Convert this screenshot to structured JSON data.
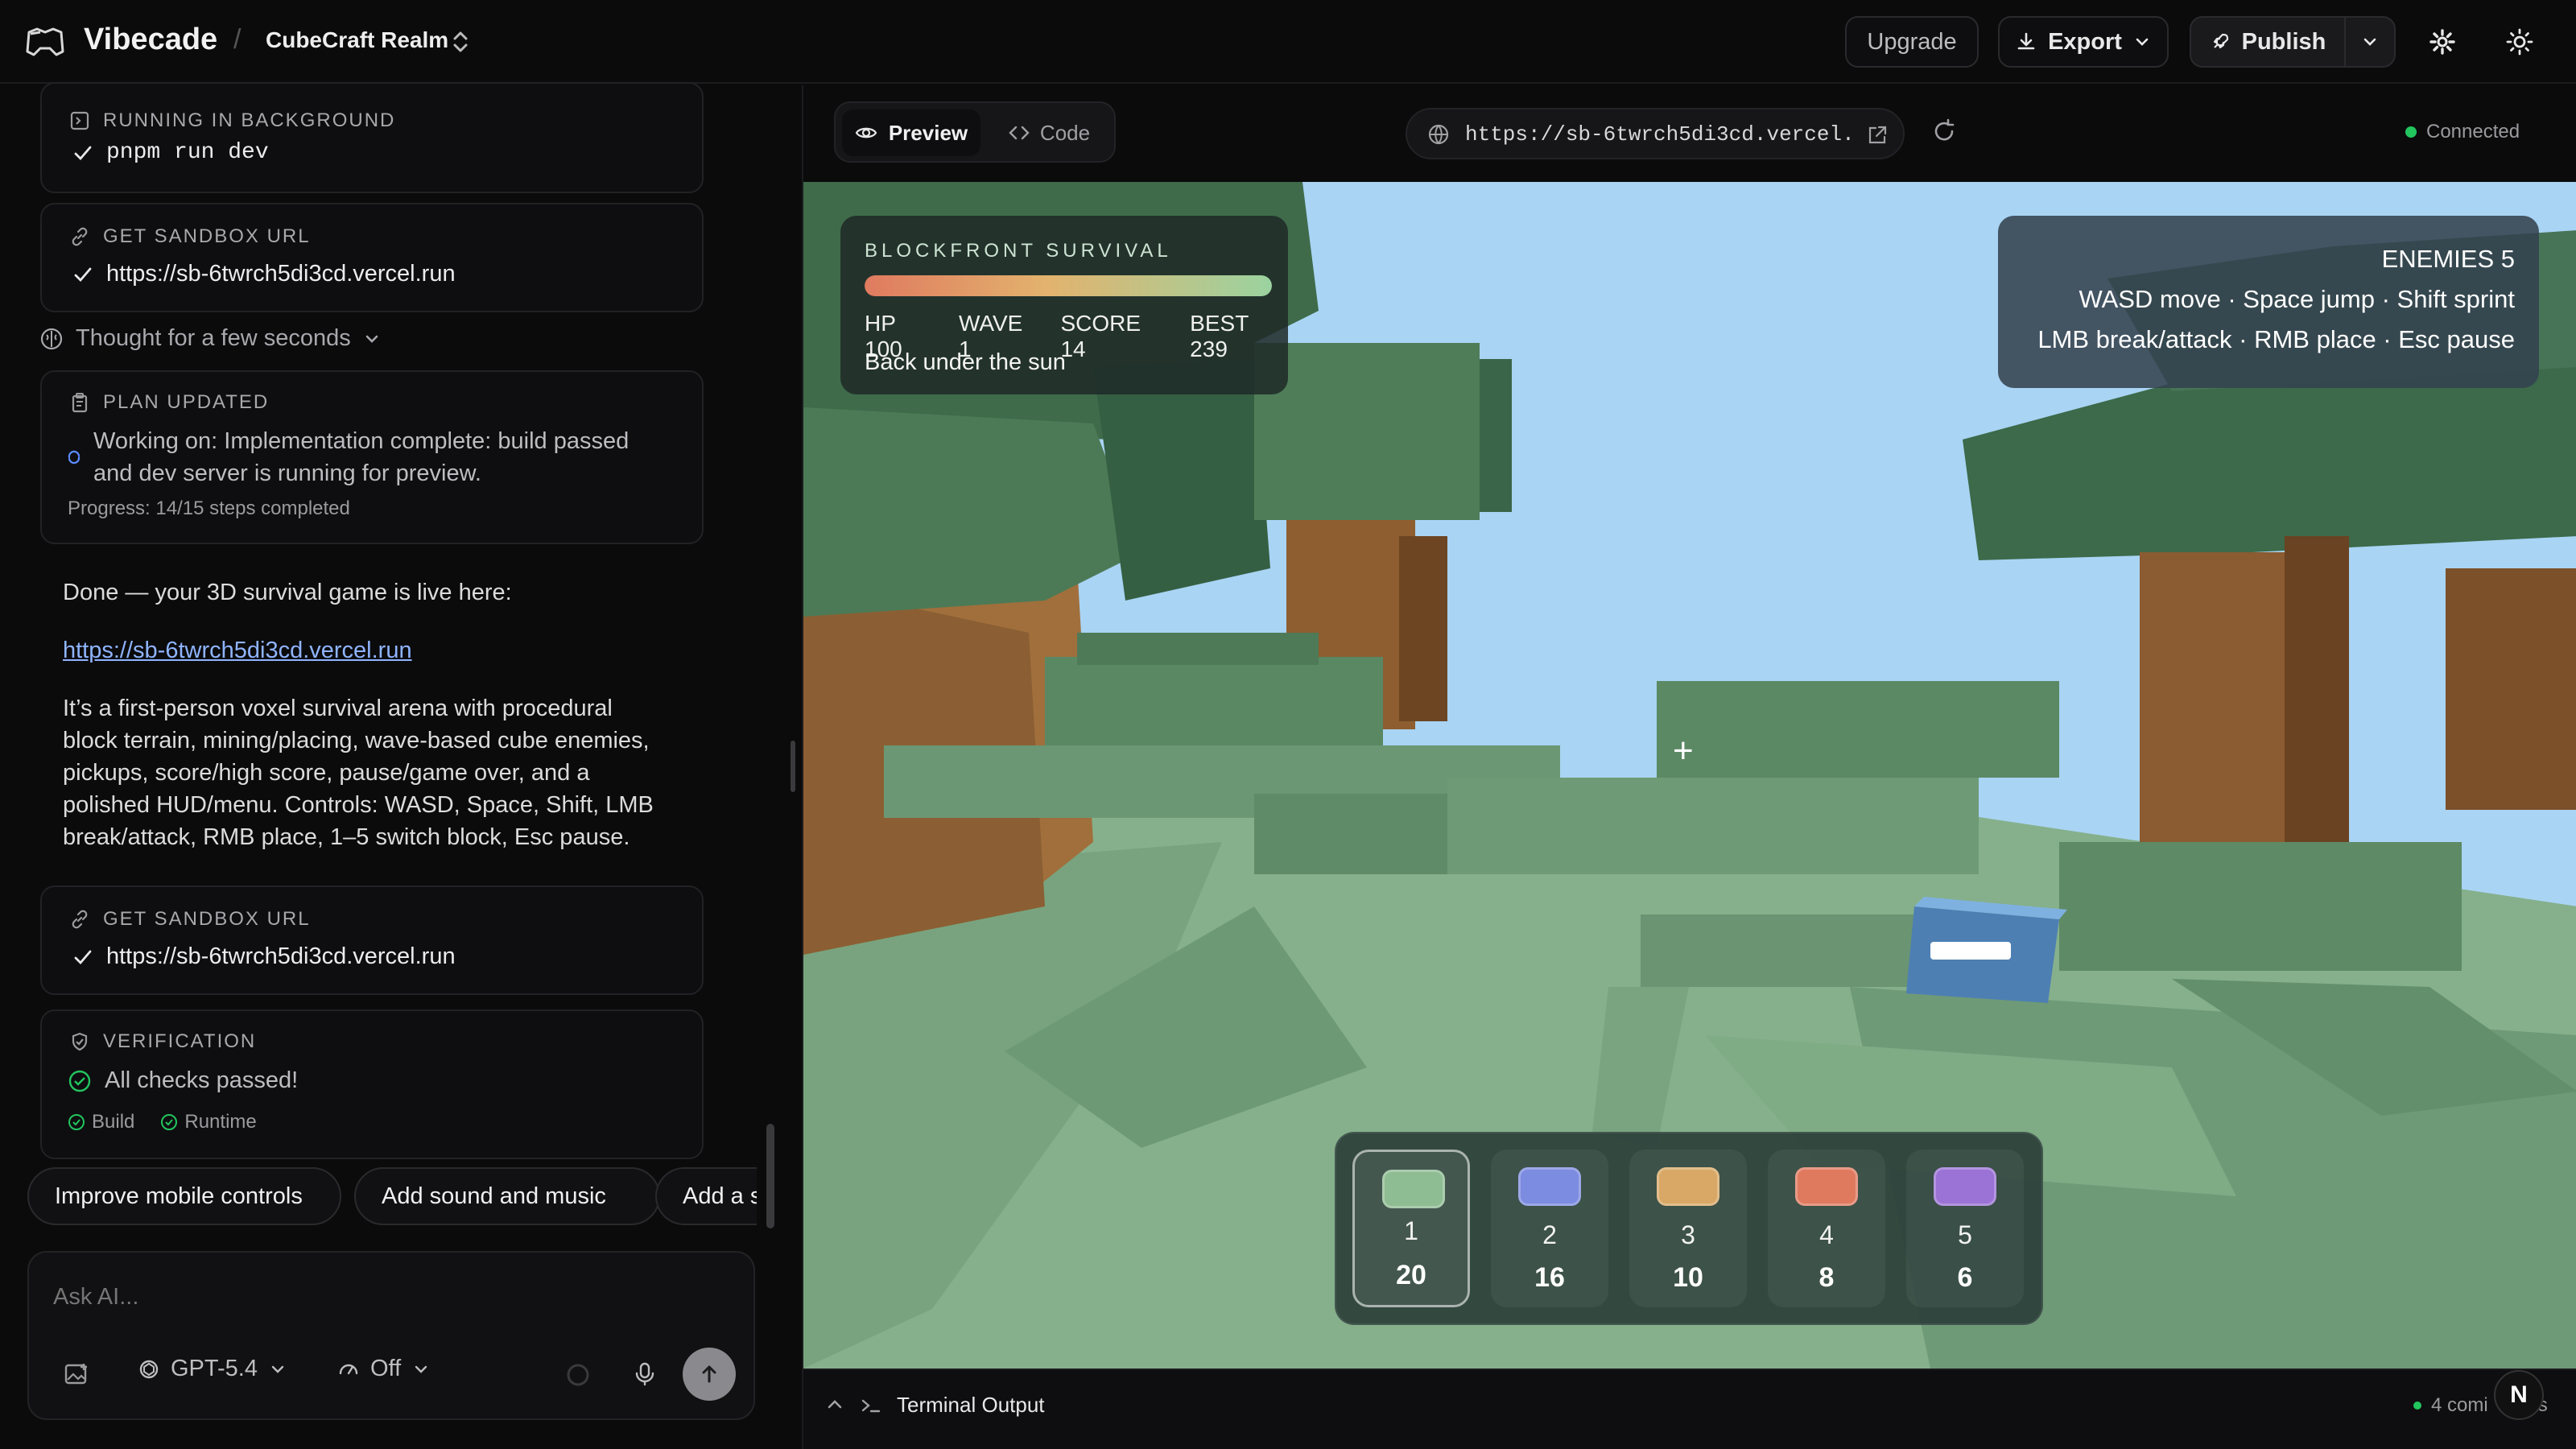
{
  "app": {
    "brand": "Vibecade",
    "separator": "/",
    "project_name": "CubeCraft Realm"
  },
  "header": {
    "upgrade_label": "Upgrade",
    "export_label": "Export",
    "publish_label": "Publish"
  },
  "chat": {
    "running_card": {
      "title": "RUNNING IN BACKGROUND",
      "command": "pnpm run dev"
    },
    "sandbox_card_1": {
      "title": "GET SANDBOX URL",
      "url": "https://sb-6twrch5di3cd.vercel.run"
    },
    "thought": "Thought for a few seconds",
    "plan_card": {
      "title": "PLAN UPDATED",
      "line1": "Working on: Implementation complete: build passed",
      "line2": "and dev server is running for preview.",
      "progress": "Progress: 14/15 steps completed"
    },
    "done_text": "Done — your 3D survival game is live here:",
    "live_link": "https://sb-6twrch5di3cd.vercel.run",
    "description_lines": [
      "It’s a first-person voxel survival arena with procedural",
      "block terrain, mining/placing, wave-based cube enemies,",
      "pickups, score/high score, pause/game over, and a",
      "polished HUD/menu. Controls: WASD, Space, Shift, LMB",
      "break/attack, RMB place, 1–5 switch block, Esc pause."
    ],
    "sandbox_card_2": {
      "title": "GET SANDBOX URL",
      "url": "https://sb-6twrch5di3cd.vercel.run"
    },
    "verification_card": {
      "title": "VERIFICATION",
      "status": "All checks passed!",
      "check_build": "Build",
      "check_runtime": "Runtime"
    },
    "suggestions": [
      "Improve mobile controls",
      "Add sound and music",
      "Add a s"
    ],
    "composer": {
      "placeholder": "Ask AI...",
      "model": "GPT-5.4",
      "reasoning": "Off"
    }
  },
  "preview": {
    "tab_preview": "Preview",
    "tab_code": "Code",
    "url": "https://sb-6twrch5di3cd.vercel.",
    "connection_status": "Connected",
    "status_color": "#22c55e",
    "terminal_label": "Terminal Output",
    "terminal_count": "4 comi",
    "terminal_count_tail": "s",
    "avatar_letter": "N"
  },
  "game": {
    "title": "BLOCKFRONT SURVIVAL",
    "hp": "HP 100",
    "wave": "WAVE 1",
    "score": "SCORE 14",
    "best": "BEST 239",
    "status": "Back under the sun",
    "health_fraction": 1.0,
    "enemies": "ENEMIES 5",
    "controls_line1": "WASD move · Space jump · Shift sprint",
    "controls_line2": "LMB break/attack · RMB place · Esc pause",
    "crosshair": "+",
    "hotbar": [
      {
        "slot": "1",
        "count": "20",
        "color": "#8fbd93",
        "selected": true
      },
      {
        "slot": "2",
        "count": "16",
        "color": "#7c8ce0",
        "selected": false
      },
      {
        "slot": "3",
        "count": "10",
        "color": "#d9a866",
        "selected": false
      },
      {
        "slot": "4",
        "count": "8",
        "color": "#e07a5f",
        "selected": false
      },
      {
        "slot": "5",
        "count": "6",
        "color": "#9b72d6",
        "selected": false
      }
    ]
  }
}
